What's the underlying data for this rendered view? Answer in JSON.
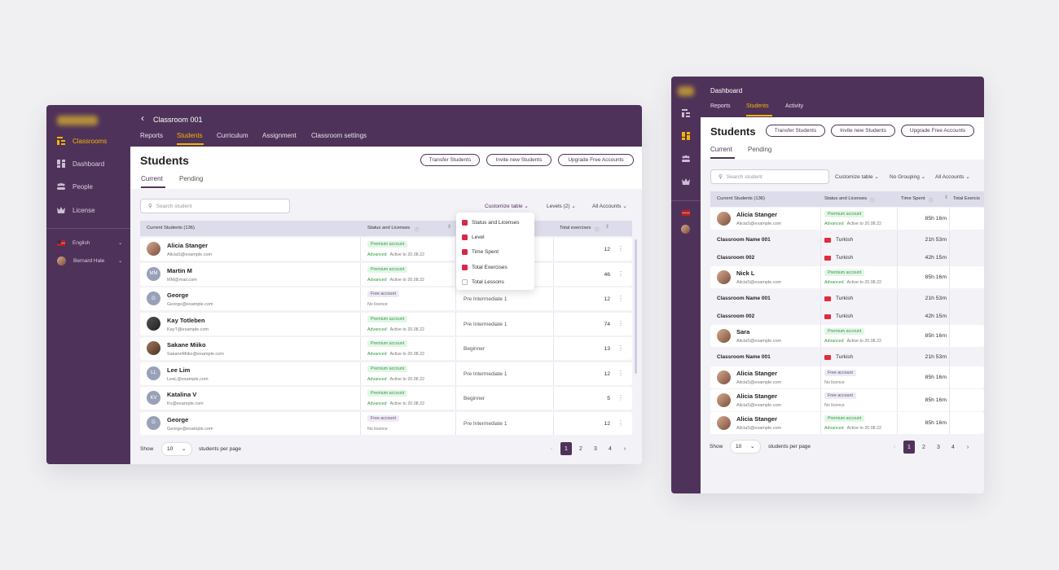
{
  "left": {
    "sidebar": {
      "items": [
        {
          "label": "Classrooms",
          "icon": "classrooms-icon",
          "active": true
        },
        {
          "label": "Dashboard",
          "icon": "dashboard-icon"
        },
        {
          "label": "People",
          "icon": "people-icon"
        },
        {
          "label": "License",
          "icon": "license-icon"
        }
      ],
      "language": "English",
      "user": "Bernard Hale"
    },
    "header": {
      "title": "Classroom 001",
      "tabs": [
        "Reports",
        "Students",
        "Curriculum",
        "Assignment",
        "Classroom settings"
      ]
    },
    "page_title": "Students",
    "subtabs": [
      "Current",
      "Pending"
    ],
    "buttons": [
      "Transfer Students",
      "Invite new Students",
      "Upgrade Free Accounts"
    ],
    "search_placeholder": "Search student",
    "filters": {
      "customize": "Customize table",
      "levels": "Levels (2)",
      "accounts": "All Accounts"
    },
    "columns": {
      "students": "Current Students (136)",
      "status": "Status and Licenses",
      "exercises": "Total exercises"
    },
    "menu": [
      {
        "label": "Status and Licenses",
        "checked": true
      },
      {
        "label": "Level",
        "checked": true
      },
      {
        "label": "Time Spent",
        "checked": true
      },
      {
        "label": "Total Exercises",
        "checked": true
      },
      {
        "label": "Total Lessons",
        "checked": false
      }
    ],
    "rows": [
      {
        "name": "Alicia Stanger",
        "email": "AliciaS@example.com",
        "initials": "",
        "badge": "Premium account",
        "plan": "Advanced",
        "note": "Active to 20.08.22",
        "level": "",
        "ex": "12"
      },
      {
        "name": "Martin M",
        "email": "MM@mail.com",
        "initials": "MM",
        "badge": "Premium account",
        "plan": "Advanced",
        "note": "Active to 20.08.22",
        "level": "",
        "ex": "46"
      },
      {
        "name": "George",
        "email": "George@example.com",
        "initials": "G",
        "badge": "Free account",
        "plan": "",
        "note": "No licence",
        "level": "Pre Intermediate 1",
        "ex": "12"
      },
      {
        "name": "Kay Totleben",
        "email": "KayT@example.com",
        "initials": "",
        "badge": "Premium account",
        "plan": "Advanced",
        "note": "Active to 20.08.22",
        "level": "Pre Intermediate 1",
        "ex": "74"
      },
      {
        "name": "Sakane Miiko",
        "email": "SakaneMiiko@example.com",
        "initials": "",
        "badge": "Premium account",
        "plan": "Advanced",
        "note": "Active to 20.08.22",
        "level": "Beginner",
        "ex": "13"
      },
      {
        "name": "Lee Lim",
        "email": "LeeL@example.com",
        "initials": "LL",
        "badge": "Premium account",
        "plan": "Advanced",
        "note": "Active to 20.08.22",
        "level": "Pre Intermediate 1",
        "ex": "12"
      },
      {
        "name": "Katalina V",
        "email": "Kv@example.com",
        "initials": "KV",
        "badge": "Premium account",
        "plan": "Advanced",
        "note": "Active to 20.08.22",
        "level": "Beginner",
        "ex": "5"
      },
      {
        "name": "George",
        "email": "George@example.com",
        "initials": "G",
        "badge": "Free account",
        "plan": "",
        "note": "No licence",
        "level": "Pre Intermediate 1",
        "ex": "12"
      }
    ],
    "footer": {
      "show": "Show",
      "per_page_value": "10",
      "per_page_label": "students per page",
      "pages": [
        "1",
        "2",
        "3",
        "4"
      ]
    }
  },
  "right": {
    "header": {
      "title": "Dashboard",
      "tabs": [
        "Reports",
        "Students",
        "Activity"
      ]
    },
    "page_title": "Students",
    "subtabs": [
      "Current",
      "Pending"
    ],
    "buttons": [
      "Transfer Students",
      "Invite new Students",
      "Upgrade Free Accounts"
    ],
    "search_placeholder": "Search student",
    "filters": {
      "customize": "Customize table",
      "grouping": "No Grouping",
      "accounts": "All Accounts"
    },
    "columns": {
      "students": "Current Students (136)",
      "status": "Status and Licenses",
      "time": "Time Spent",
      "exercises": "Total Exercis"
    },
    "rows": [
      {
        "type": "student",
        "name": "Alicia Stanger",
        "email": "AliciaS@example.com",
        "badge": "Premium account",
        "plan": "Advanced",
        "note": "Active to 20.08.22",
        "time": "85h 16m"
      },
      {
        "type": "class",
        "name": "Classroom Name 001",
        "lang": "Turkish",
        "time": "21h 53m"
      },
      {
        "type": "class",
        "name": "Classroom  002",
        "lang": "Turkish",
        "time": "42h 15m"
      },
      {
        "type": "student",
        "name": "Nick L",
        "email": "AliciaS@example.com",
        "badge": "Premium account",
        "plan": "Advanced",
        "note": "Active to 20.08.22",
        "time": "85h 16m"
      },
      {
        "type": "class",
        "name": "Classroom Name 001",
        "lang": "Turkish",
        "time": "21h 53m"
      },
      {
        "type": "class",
        "name": "Classroom  002",
        "lang": "Turkish",
        "time": "42h 15m"
      },
      {
        "type": "student",
        "name": "Sara",
        "email": "AliciaS@example.com",
        "badge": "Premium account",
        "plan": "Advanced",
        "note": "Active to 20.08.22",
        "time": "85h 16m"
      },
      {
        "type": "class",
        "name": "Classroom Name 001",
        "lang": "Turkish",
        "time": "21h 53m"
      },
      {
        "type": "student",
        "name": "Alicia Stanger",
        "email": "AliciaS@example.com",
        "badge": "Free account",
        "plan": "",
        "note": "No licence",
        "time": "85h 16m"
      },
      {
        "type": "student",
        "name": "Alicia Stanger",
        "email": "AliciaS@example.com",
        "badge": "Free account",
        "plan": "",
        "note": "No licence",
        "time": "85h 16m"
      },
      {
        "type": "student",
        "name": "Alicia Stanger",
        "email": "AliciaS@example.com",
        "badge": "Premium account",
        "plan": "Advanced",
        "note": "Active to 20.08.22",
        "time": "85h 16m"
      }
    ],
    "footer": {
      "show": "Show",
      "per_page_value": "10",
      "per_page_label": "students per page",
      "pages": [
        "1",
        "2",
        "3",
        "4"
      ]
    }
  },
  "colors": {
    "brand": "#4f3259",
    "accent": "#f5b400",
    "premium": "#3a9b4a",
    "check": "#d6284a"
  }
}
